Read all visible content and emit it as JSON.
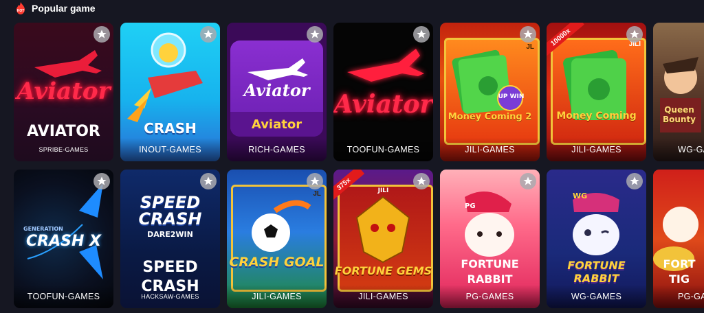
{
  "section": {
    "title": "Popular game",
    "hot_badge": "HOT"
  },
  "row1": [
    {
      "logo": "Aviator",
      "name": "AVIATOR",
      "provider": "SPRIBE-GAMES"
    },
    {
      "logo": "CRASH",
      "provider": "INOUT-GAMES"
    },
    {
      "logo": "Aviator",
      "name": "Aviator",
      "provider": "RICH-GAMES"
    },
    {
      "logo": "Aviator",
      "provider": "TOOFUN-GAMES"
    },
    {
      "logo": "Money Coming 2",
      "badge": "JL",
      "subbadge": "UP WIN",
      "provider": "JILI-GAMES"
    },
    {
      "logo": "Money Coming",
      "badge": "JILI",
      "ribbon": "10000x",
      "provider": "JILI-GAMES"
    },
    {
      "logo": "Queen Bounty",
      "provider": "WG-GAMES"
    }
  ],
  "row2": [
    {
      "logo": "CRASH X",
      "sublogo": "GENERATION",
      "provider": "TOOFUN-GAMES"
    },
    {
      "logo": "SPEED CRASH",
      "sublogo": "DARE2WIN",
      "name1": "SPEED",
      "name2": "CRASH",
      "provider": "HACKSAW-GAMES"
    },
    {
      "logo": "CRASH GOAL",
      "badge": "JL",
      "provider": "JILI-GAMES"
    },
    {
      "logo": "FORTUNE GEMS",
      "badge": "JILI",
      "ribbon": "375x",
      "provider": "JILI-GAMES"
    },
    {
      "logo": "PG",
      "name1": "FORTUNE",
      "name2": "RABBIT",
      "provider": "PG-GAMES"
    },
    {
      "logo": "FORTUNE RABBIT",
      "badge": "WG",
      "provider": "WG-GAMES"
    },
    {
      "name1": "FORT",
      "name2": "TIG",
      "provider": "PG-GA"
    }
  ],
  "colors": {
    "background": "#161722",
    "fav_button": "#aaaaaf",
    "neon_red": "#ff2a4a"
  },
  "icons": {
    "favorite": "star-icon",
    "hot": "fire-icon"
  }
}
